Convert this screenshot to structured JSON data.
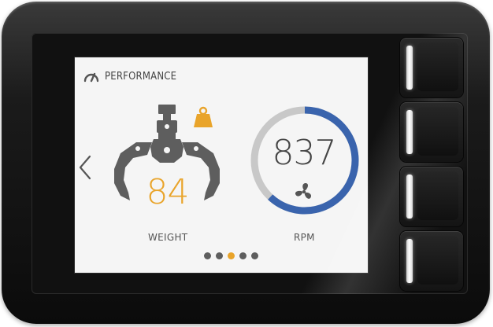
{
  "header": {
    "title": "PERFORMANCE",
    "icon": "speedometer-icon"
  },
  "navigation": {
    "prev_icon": "chevron-left-icon"
  },
  "weight": {
    "value": "84",
    "label": "WEIGHT",
    "icons": [
      "grapple-claw-icon",
      "weight-icon"
    ]
  },
  "rpm": {
    "value": "837",
    "label": "RPM",
    "icon": "fan-icon",
    "gauge_fraction": 0.62
  },
  "pager": {
    "count": 5,
    "active_index": 2
  },
  "side_buttons": [
    "button-1",
    "button-2",
    "button-3",
    "button-4"
  ],
  "colors": {
    "accent": "#e9a42a",
    "gauge_active": "#3a64ad",
    "gauge_track": "#c8c8c8",
    "screen_bg": "#f5f5f5",
    "icon_gray": "#5e5e5e"
  }
}
